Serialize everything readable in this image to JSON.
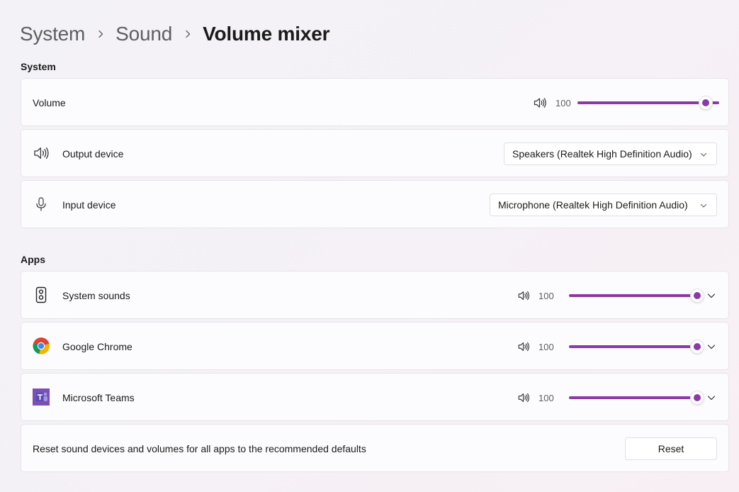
{
  "breadcrumb": {
    "items": [
      "System",
      "Sound",
      "Volume mixer"
    ]
  },
  "sections": {
    "system": "System",
    "apps": "Apps"
  },
  "system_volume": {
    "label": "Volume",
    "value": "100",
    "level_percent": 100,
    "icon": "speaker-icon"
  },
  "output_device": {
    "label": "Output device",
    "selected": "Speakers (Realtek High Definition Audio)",
    "icon": "speaker-icon"
  },
  "input_device": {
    "label": "Input device",
    "selected": "Microphone (Realtek High Definition Audio)",
    "icon": "microphone-icon"
  },
  "apps": [
    {
      "name": "System sounds",
      "value": "100",
      "level_percent": 100,
      "icon": "system-sounds-icon"
    },
    {
      "name": "Google Chrome",
      "value": "100",
      "level_percent": 100,
      "icon": "chrome-icon"
    },
    {
      "name": "Microsoft Teams",
      "value": "100",
      "level_percent": 100,
      "icon": "teams-icon"
    }
  ],
  "reset": {
    "description": "Reset sound devices and volumes for all apps to the recommended defaults",
    "button_label": "Reset"
  },
  "colors": {
    "accent": "#8b39a6",
    "background": "#f3f2f7",
    "card": "#fcfbfd"
  }
}
